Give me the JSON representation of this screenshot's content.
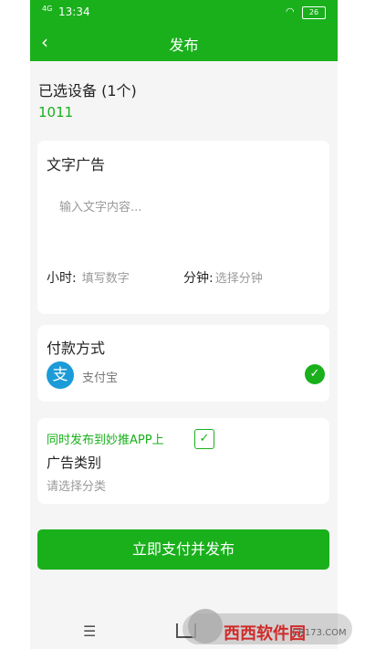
{
  "status": {
    "signal": "4G",
    "time": "13:34",
    "battery": "26"
  },
  "header": {
    "title": "发布",
    "back_icon": "chevron-left-icon"
  },
  "selected_devices": {
    "label": "已选设备 (1个)",
    "value": "1011"
  },
  "ad_card": {
    "title": "文字广告",
    "placeholder": "输入文字内容...",
    "hours_label": "小时:",
    "hours_placeholder": "填写数字",
    "minutes_label": "分钟:",
    "minutes_placeholder": "选择分钟"
  },
  "payment": {
    "title": "付款方式",
    "method": "支付宝",
    "icon": "支",
    "selected": true
  },
  "category": {
    "sync_label": "同时发布到妙推APP上",
    "sync_checked": true,
    "title": "广告类别",
    "placeholder": "请选择分类"
  },
  "submit_label": "立即支付并发布",
  "watermark": {
    "text": "西西软件园",
    "sub": "CR173.COM"
  },
  "colors": {
    "accent": "#19b01c",
    "alipay": "#1b9bd7"
  }
}
